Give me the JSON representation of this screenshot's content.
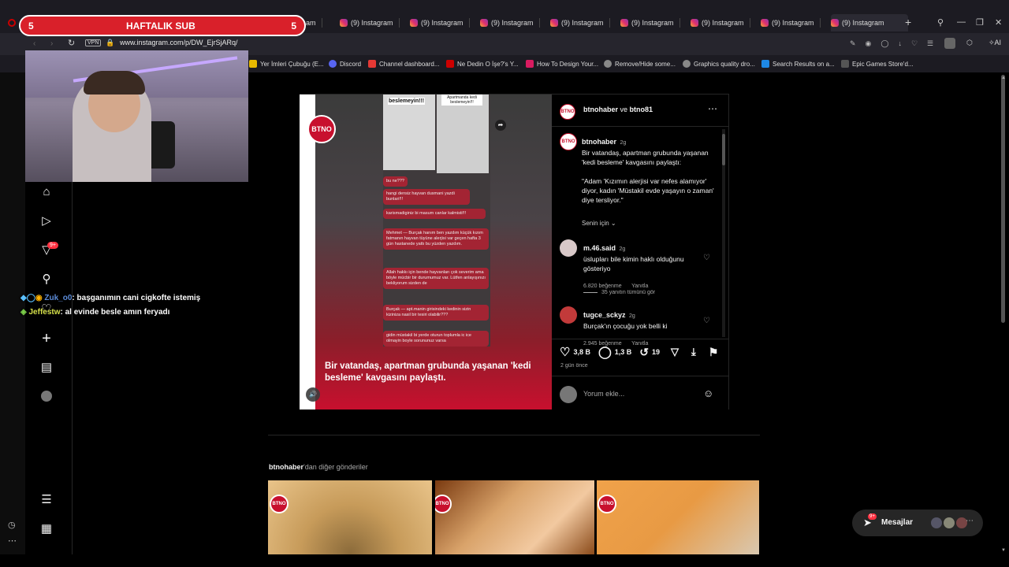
{
  "stream": {
    "sub_left": "5",
    "sub_title": "HAFTALIK SUB",
    "sub_right": "5",
    "chat": [
      {
        "user": "Zuk_o0",
        "message": ": başganımın cani cigkofte istemiş"
      },
      {
        "user": "Jeffestw",
        "message": ": al evinde besle amın feryadı"
      }
    ]
  },
  "browser": {
    "tabs": [
      {
        "label": "(9) Instagram"
      },
      {
        "label": "(9) Instagram"
      },
      {
        "label": "(9) Instagram"
      },
      {
        "label": "(9) Instagram"
      },
      {
        "label": "(9) Instagram"
      },
      {
        "label": "(9) Instagram"
      },
      {
        "label": "(9) Instagram"
      },
      {
        "label": "(9) Instagram"
      }
    ],
    "partial_tab": "am",
    "url": "www.instagram.com/p/DW_EjrSjARq/",
    "vpn": "VPN",
    "ai_label": "AI",
    "bookmarks": [
      {
        "label": "Yer İmleri Çubuğu (E...",
        "color": "#e6b800"
      },
      {
        "label": "Discord",
        "color": "#5865f2"
      },
      {
        "label": "Channel dashboard...",
        "color": "#e53935"
      },
      {
        "label": "Ne Dedin O İşe?'s Y...",
        "color": "#cc0000"
      },
      {
        "label": "How To Design Your...",
        "color": "#d81b60"
      },
      {
        "label": "Remove/Hide some...",
        "color": "#888888"
      },
      {
        "label": "Graphics quality dro...",
        "color": "#888888"
      },
      {
        "label": "Search Results on a...",
        "color": "#1e88e5"
      },
      {
        "label": "Epic Games Store'd...",
        "color": "#555555"
      }
    ]
  },
  "instagram": {
    "nav_badge": "9+",
    "post": {
      "header_user1": "btnohaber",
      "header_and": "ve",
      "header_user2": "btno81",
      "caption_user": "btnohaber",
      "caption_time": "2g",
      "caption_text1": "Bir vatandaş, apartman grubunda yaşanan 'kedi besleme' kavgasını paylaştı:",
      "caption_text2": "\"Adam 'Kızımın alerjisi var nefes alamıyor' diyor, kadın 'Müstakil evde yaşayın o zaman' diye tersliyor.\"",
      "senin_icin": "Senin için",
      "comments": [
        {
          "user": "m.46.said",
          "time": "2g",
          "text": "üslupları bile kimin haklı olduğunu gösteriyo",
          "likes": "6.820 beğenme",
          "reply": "Yanıtla"
        },
        {
          "user": "tugce_sckyz",
          "time": "2g",
          "text": "Burçak'ın çocuğu yok belli ki",
          "likes": "2.945 beğenme",
          "reply": "Yanıtla"
        }
      ],
      "view_replies": "35 yanıtın tümünü gör",
      "like_count": "3,8 B",
      "comment_count": "1,3 B",
      "repost_count": "19",
      "posted_ago": "2 gün önce",
      "comment_placeholder": "Yorum ekle...",
      "media_caption": "Bir vatandaş, apartman grubunda yaşanan 'kedi besleme' kavgasını paylaştı.",
      "logo": "BTNO",
      "chat_top_left": "beslemeyin!!!",
      "chat_top_right": "Apartmanda kedi beslemeyin!!!",
      "chat_bubbles": [
        "bu ne???",
        "hangi densiz hayvan dusmani yazdi bunlari!!!",
        "karismadiginiz bi masum canlar kalmisti!!!",
        "Mehmet — Burçak hanım ben yazdım küçük kızım fatmanın hayvan tüyüne alerjisi var geçen hafta 3 gün hastanede yattı bu yüzden yazdım.",
        "Allah hakkı için bende hayvanları çok severim ama böyle mücbir bir durumumuz var. Lütfen anlayışınızı bekliyorum sizden de",
        "Burçak — apt.manin girisindeki kedinin sizin kiziniza nasil bir tesiri olabilir???",
        "gidin müstakil bi yerde oturun toplumla ic ice olmayin boyle sorununuz varsa"
      ]
    },
    "more_posts_user": "btnohaber",
    "more_posts_suffix": "'dan diğer gönderiler",
    "messages_label": "Mesajlar",
    "messages_badge": "9+"
  }
}
